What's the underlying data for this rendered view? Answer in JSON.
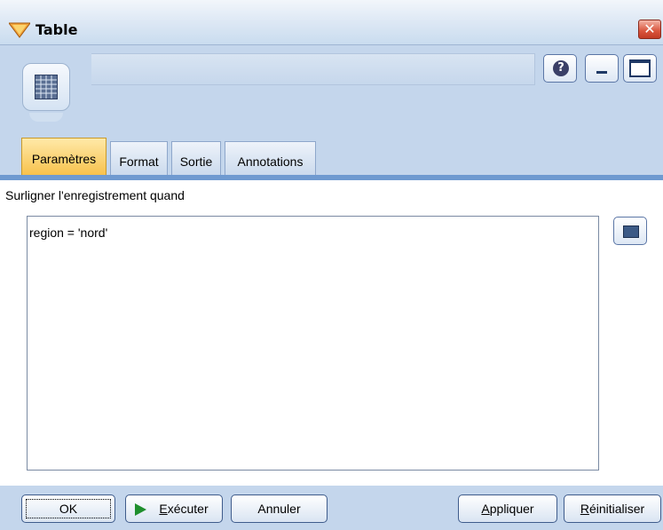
{
  "window": {
    "title": "Table",
    "close_label": "✕"
  },
  "header": {
    "help_label": "?",
    "node_icon": "table-grid-icon"
  },
  "tabs": [
    {
      "label": "Paramètres",
      "active": true
    },
    {
      "label": "Format",
      "active": false
    },
    {
      "label": "Sortie",
      "active": false
    },
    {
      "label": "Annotations",
      "active": false
    }
  ],
  "settings": {
    "highlight_label": "Surligner l'enregistrement quand",
    "expression": "region = 'nord'"
  },
  "buttons": {
    "ok": "OK",
    "run_first": "E",
    "run_rest": "xécuter",
    "cancel": "Annuler",
    "apply_first": "A",
    "apply_rest": "ppliquer",
    "reset_first": "R",
    "reset_rest": "éinitialiser"
  },
  "colors": {
    "chrome": "#c4d6ec",
    "active_tab": "#f7c24d",
    "tab_bar": "#6f9ad0",
    "close": "#d9543c",
    "run_icon": "#1f8f2d"
  }
}
